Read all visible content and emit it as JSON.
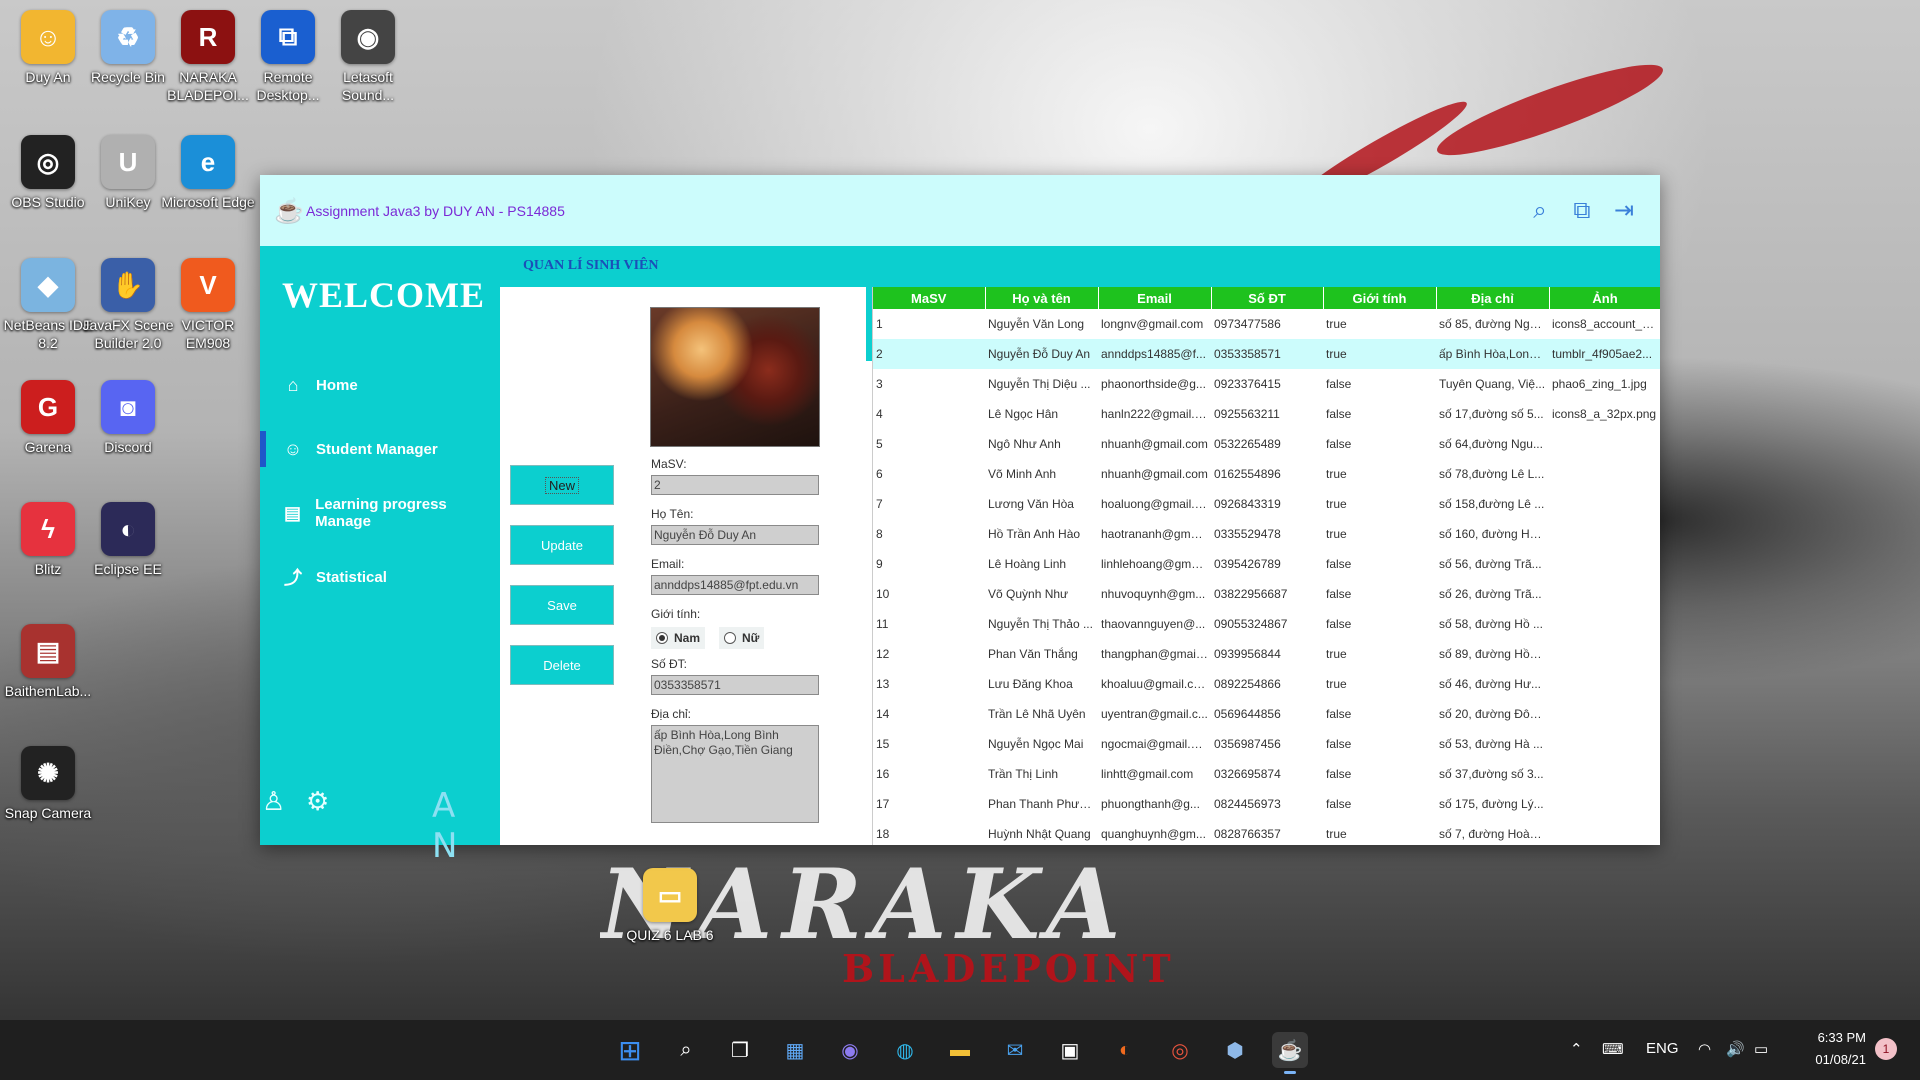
{
  "desktop": {
    "icons": [
      {
        "label": "Duy An",
        "icon": "user-folder-icon"
      },
      {
        "label": "Recycle Bin",
        "icon": "recycle-bin-icon"
      },
      {
        "label": "NARAKA BLADEPOI...",
        "icon": "naraka-game-icon"
      },
      {
        "label": "Remote Desktop...",
        "icon": "remote-desktop-icon"
      },
      {
        "label": "Letasoft Sound...",
        "icon": "speaker-icon"
      },
      {
        "label": "OBS Studio",
        "icon": "obs-icon"
      },
      {
        "label": "UniKey",
        "icon": "unikey-icon"
      },
      {
        "label": "Microsoft Edge",
        "icon": "edge-icon"
      },
      {
        "label": "NetBeans IDE 8.2",
        "icon": "netbeans-icon"
      },
      {
        "label": "JavaFX Scene Builder 2.0",
        "icon": "scene-builder-icon"
      },
      {
        "label": "VICTOR EM908",
        "icon": "victor-icon"
      },
      {
        "label": "Garena",
        "icon": "garena-icon"
      },
      {
        "label": "Discord",
        "icon": "discord-icon"
      },
      {
        "label": "Blitz",
        "icon": "blitz-icon"
      },
      {
        "label": "Eclipse EE",
        "icon": "eclipse-icon"
      },
      {
        "label": "BaithemLab...",
        "icon": "winrar-icon"
      },
      {
        "label": "Snap Camera",
        "icon": "snap-camera-icon"
      },
      {
        "label": "QUIZ 6 LAB 6",
        "icon": "folder-icon"
      }
    ],
    "wallpaper_logo": "NARAKA",
    "wallpaper_sub": "BLADEPOINT"
  },
  "window": {
    "title": "Assignment Java3 by DUY AN - PS14885",
    "section_title": "QUAN LÍ SINH VIÊN",
    "sidebar": {
      "welcome": "WELCOME",
      "items": [
        {
          "label": "Home",
          "icon": "home-icon"
        },
        {
          "label": "Student Manager",
          "icon": "student-icon"
        },
        {
          "label": "Learning progress Manage",
          "icon": "book-icon"
        },
        {
          "label": "Statistical",
          "icon": "chart-icon"
        }
      ],
      "logo": "A N"
    },
    "form": {
      "buttons": {
        "new": "New",
        "update": "Update",
        "save": "Save",
        "delete": "Delete"
      },
      "masv_label": "MaSV:",
      "masv_value": "2",
      "hoten_label": "Họ Tên:",
      "hoten_value": "Nguyễn Đỗ Duy An",
      "email_label": "Email:",
      "email_value": "annddps14885@fpt.edu.vn",
      "gioitinh_label": "Giới tính:",
      "gender_male": "Nam",
      "gender_female": "Nữ",
      "sodt_label": "Số ĐT:",
      "sodt_value": "0353358571",
      "diachi_label": "Địa chỉ:",
      "diachi_value": "ấp Bình Hòa,Long Bình Điền,Chợ Gạo,Tiền Giang"
    },
    "table": {
      "headers": [
        "MaSV",
        "Họ và tên",
        "Email",
        "Số ĐT",
        "Giới tính",
        "Địa chỉ",
        "Ảnh"
      ],
      "rows": [
        [
          "1",
          "Nguyễn Văn Long",
          "longnv@gmail.com",
          "0973477586",
          "true",
          "số 85, đường Ngu...",
          "icons8_account_3..."
        ],
        [
          "2",
          "Nguyễn Đỗ Duy An",
          "annddps14885@f...",
          "0353358571",
          "true",
          "ấp Bình Hòa,Long ...",
          "tumblr_4f905ae2..."
        ],
        [
          "3",
          "Nguyễn Thị Diệu ...",
          "phaonorthside@g...",
          "0923376415",
          "false",
          "Tuyên Quang, Việ...",
          "phao6_zing_1.jpg"
        ],
        [
          "4",
          "Lê Ngọc Hân",
          "hanln222@gmail.c...",
          "0925563211",
          "false",
          "số 17,đường số 5...",
          "icons8_a_32px.png"
        ],
        [
          "5",
          "Ngô Như Anh",
          "nhuanh@gmail.com",
          "0532265489",
          "false",
          "số 64,đường Ngu...",
          ""
        ],
        [
          "6",
          "Võ Minh Anh",
          "nhuanh@gmail.com",
          "0162554896",
          "true",
          "số 78,đường Lê L...",
          ""
        ],
        [
          "7",
          "Lương Văn Hòa",
          "hoaluong@gmail.c...",
          "0926843319",
          "true",
          "số 158,đường Lê ...",
          ""
        ],
        [
          "8",
          "Hồ Trần Anh Hào",
          "haotrananh@gmai...",
          "0335529478",
          "true",
          "số 160, đường Hò...",
          ""
        ],
        [
          "9",
          "Lê Hoàng Linh",
          "linhlehoang@gmail...",
          "0395426789",
          "false",
          "số 56, đường Trã...",
          ""
        ],
        [
          "10",
          "Võ Quỳnh Như",
          "nhuvoquynh@gm...",
          "03822956687",
          "false",
          "số 26, đường Trã...",
          ""
        ],
        [
          "11",
          "Nguyễn Thị Thảo ...",
          "thaovannguyen@...",
          "09055324867",
          "false",
          "số 58, đường Hồ ...",
          ""
        ],
        [
          "12",
          "Phan Văn Thắng",
          "thangphan@gmail...",
          "0939956844",
          "true",
          "số 89, đường Hồn...",
          ""
        ],
        [
          "13",
          "Lưu Đăng Khoa",
          "khoaluu@gmail.com",
          "0892254866",
          "true",
          "số 46, đường Hư...",
          ""
        ],
        [
          "14",
          "Trần Lê Nhã Uyên",
          "uyentran@gmail.c...",
          "0569644856",
          "false",
          "số 20, đường Đôn...",
          ""
        ],
        [
          "15",
          "Nguyễn Ngọc Mai",
          "ngocmai@gmail.com",
          "0356987456",
          "false",
          "số 53, đường Hà ...",
          ""
        ],
        [
          "16",
          "Trần Thị Linh",
          "linhtt@gmail.com",
          "0326695874",
          "false",
          "số 37,đường số 3...",
          ""
        ],
        [
          "17",
          "Phan Thanh Phươ...",
          "phuongthanh@g...",
          "0824456973",
          "false",
          "số 175, đường Lý...",
          ""
        ],
        [
          "18",
          "Huỳnh Nhật Quang",
          "quanghuynh@gm...",
          "0828766357",
          "true",
          "số 7, đường Hoàn...",
          ""
        ]
      ],
      "selected_index": 1
    }
  },
  "taskbar": {
    "language": "ENG",
    "time": "6:33 PM",
    "date": "01/08/21",
    "notifications": "1"
  },
  "colors": {
    "teal": "#0ccfcf",
    "titlebar": "#ccfcfc",
    "header_green": "#1ec21e",
    "selected_row": "#ccfcfc"
  }
}
